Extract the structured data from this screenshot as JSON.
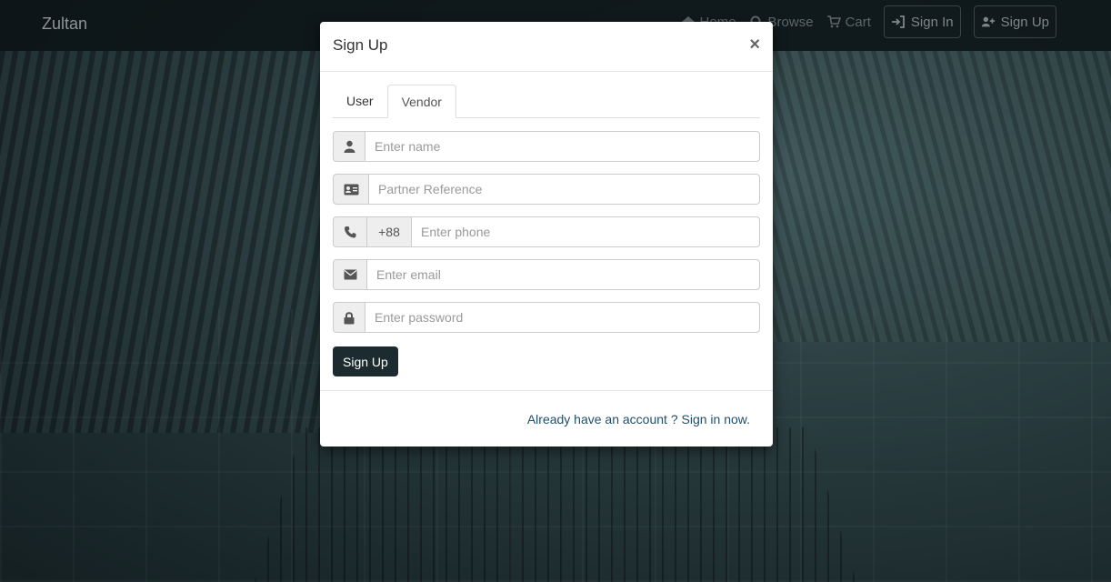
{
  "navbar": {
    "brand": "Zultan",
    "links": [
      {
        "label": "Home",
        "icon": "home-icon"
      },
      {
        "label": "Browse",
        "icon": "search-icon"
      },
      {
        "label": "Cart",
        "icon": "cart-icon"
      }
    ],
    "sign_in": "Sign In",
    "sign_up": "Sign Up"
  },
  "modal": {
    "title": "Sign Up",
    "close": "×",
    "tabs": [
      {
        "label": "User",
        "active": false
      },
      {
        "label": "Vendor",
        "active": true
      }
    ],
    "fields": {
      "name": {
        "placeholder": "Enter name",
        "icon": "user-icon"
      },
      "partner": {
        "placeholder": "Partner Reference",
        "icon": "id-card-icon"
      },
      "phone": {
        "placeholder": "Enter phone",
        "icon": "phone-icon",
        "prefix": "+88"
      },
      "email": {
        "placeholder": "Enter email",
        "icon": "envelope-icon"
      },
      "password": {
        "placeholder": "Enter password",
        "icon": "lock-icon"
      }
    },
    "submit": "Sign Up",
    "footer_link": "Already have an account ? Sign in now."
  },
  "colors": {
    "primary_button": "#1c2b2f",
    "link": "#1f4e6b"
  }
}
